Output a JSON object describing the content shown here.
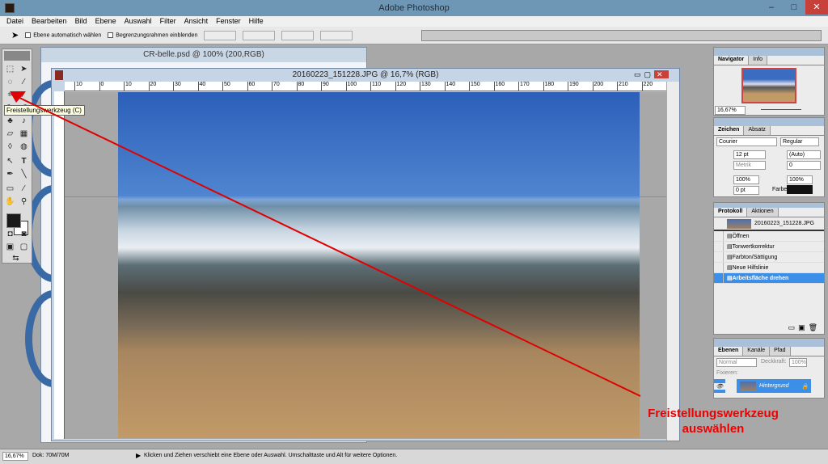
{
  "app": {
    "title": "Adobe Photoshop"
  },
  "menu": [
    "Datei",
    "Bearbeiten",
    "Bild",
    "Ebene",
    "Auswahl",
    "Filter",
    "Ansicht",
    "Fenster",
    "Hilfe"
  ],
  "options": {
    "auto_select": "Ebene automatisch wählen",
    "show_bounds": "Begrenzungsrahmen einblenden"
  },
  "windows": {
    "back": "CR-belle.psd @ 100% (200,RGB)",
    "front": "20160223_151228.JPG @ 16,7% (RGB)"
  },
  "ruler_ticks": [
    "10",
    "0",
    "10",
    "20",
    "30",
    "40",
    "50",
    "60",
    "70",
    "80",
    "90",
    "100",
    "110",
    "120",
    "130",
    "140",
    "150",
    "160",
    "170",
    "180",
    "190",
    "200",
    "210",
    "220"
  ],
  "tooltip": "Freistellungswerkzeug (C)",
  "annotation": {
    "line1": "Freistellungswerkzeug",
    "line2": "auswählen",
    "color": "#e00000"
  },
  "navigator": {
    "tabs": [
      "Navigator",
      "Info"
    ],
    "zoom": "16,67%"
  },
  "character": {
    "tabs": [
      "Zeichen",
      "Absatz"
    ],
    "font": "Courier",
    "style": "Regular",
    "size": "12 pt",
    "leading": "(Auto)",
    "kerning": "Metrik",
    "tracking": "0",
    "vscale": "100%",
    "hscale": "100%",
    "baseline": "0 pt",
    "color_label": "Farbe:"
  },
  "history": {
    "tabs": [
      "Protokoll",
      "Aktionen"
    ],
    "snapshot": "20160223_151228.JPG",
    "items": [
      "Öffnen",
      "Tonwertkorrektur",
      "Farbton/Sättigung",
      "Neue Hilfslinie",
      "Arbeitsfläche drehen"
    ]
  },
  "layers": {
    "tabs": [
      "Ebenen",
      "Kanäle",
      "Pfad"
    ],
    "mode": "Normal",
    "opacity_label": "Deckkraft:",
    "opacity": "100%",
    "lock_label": "Fixieren:",
    "layer": "Hintergrund"
  },
  "status": {
    "zoom": "16,67%",
    "doc": "Dok: 70M/70M",
    "hint": "Klicken und Ziehen verschiebt eine Ebene oder Auswahl. Umschalttaste und Alt für weitere Optionen."
  }
}
